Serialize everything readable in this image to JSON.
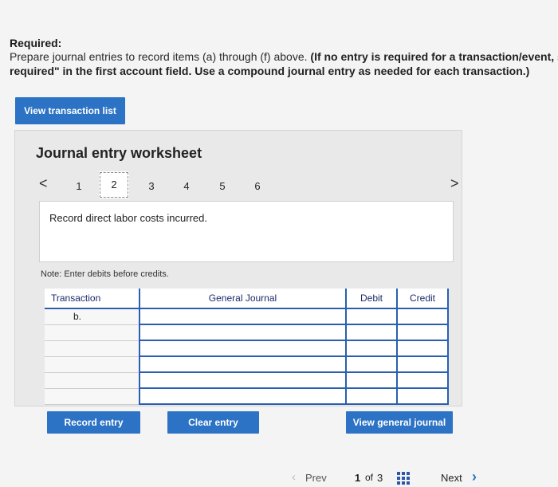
{
  "required": {
    "title": "Required:",
    "line1_plain": "Prepare journal entries to record items (a) through (f) above. ",
    "line1_bold": "(If no entry is required for a transaction/event, s",
    "line2_bold": "required\" in the first account field. Use a compound journal entry as needed for each transaction.)"
  },
  "view_transaction_list": "View transaction list",
  "worksheet": {
    "title": "Journal entry worksheet",
    "prev_arrow": "<",
    "next_arrow": ">",
    "pages": [
      "1",
      "2",
      "3",
      "4",
      "5",
      "6"
    ],
    "active_page": "2",
    "description": "Record direct labor costs incurred.",
    "note": "Note: Enter debits before credits.",
    "table": {
      "headers": [
        "Transaction",
        "General Journal",
        "Debit",
        "Credit"
      ],
      "rows": [
        {
          "transaction": "b.",
          "account": "",
          "debit": "",
          "credit": ""
        },
        {
          "transaction": "",
          "account": "",
          "debit": "",
          "credit": ""
        },
        {
          "transaction": "",
          "account": "",
          "debit": "",
          "credit": ""
        },
        {
          "transaction": "",
          "account": "",
          "debit": "",
          "credit": ""
        },
        {
          "transaction": "",
          "account": "",
          "debit": "",
          "credit": ""
        },
        {
          "transaction": "",
          "account": "",
          "debit": "",
          "credit": ""
        }
      ]
    },
    "record_entry": "Record entry",
    "clear_entry": "Clear entry",
    "view_general_journal": "View general journal"
  },
  "footer": {
    "prev": "Prev",
    "page_current": "1",
    "page_of": "of",
    "page_total": "3",
    "next": "Next"
  },
  "colors": {
    "button_blue": "#2c73c5",
    "grid_blue": "#2a5fb0",
    "header_text": "#1d2b6a"
  }
}
